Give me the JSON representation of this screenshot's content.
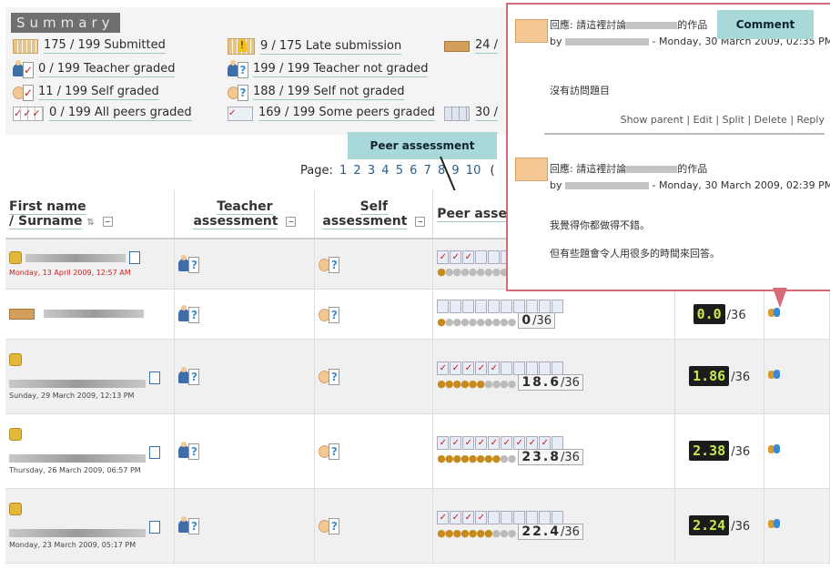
{
  "summary": {
    "title": "Summary",
    "rows": [
      {
        "label": "175 / 199 Submitted"
      },
      {
        "label": "9 / 175 Late submission"
      },
      {
        "label": "24 /"
      },
      {
        "label": "0 / 199 Teacher graded"
      },
      {
        "label": "199 / 199 Teacher not graded"
      },
      {
        "label": "11 / 199 Self graded"
      },
      {
        "label": "188 / 199 Self not graded"
      },
      {
        "label": "0 / 199 All peers graded"
      },
      {
        "label": "169 / 199 Some peers graded"
      },
      {
        "label": "30 /"
      }
    ]
  },
  "callouts": {
    "peer": "Peer assessment",
    "comment": "Comment"
  },
  "pager": {
    "label": "Page:",
    "pages": [
      "1",
      "2",
      "3",
      "4",
      "5",
      "6",
      "7",
      "8",
      "9",
      "10"
    ],
    "suffix": "("
  },
  "table": {
    "headers": {
      "name_line1": "First name",
      "name_line2": "/ Surname",
      "teacher_line1": "Teacher",
      "teacher_line2": "assessment",
      "self_line1": "Self",
      "self_line2": "assessment",
      "peer": "Peer asse"
    },
    "rows": [
      {
        "date": "Monday, 13 April 2009, 12:57 AM",
        "checks": 3,
        "score": "",
        "final": "",
        "den": ""
      },
      {
        "date": "",
        "checks": 0,
        "score": "0",
        "final": "0.0",
        "den": "/36"
      },
      {
        "date": "Sunday, 29 March 2009, 12:13 PM",
        "checks": 5,
        "score": "18.6",
        "final": "1.86",
        "den": "/36"
      },
      {
        "date": "Thursday, 26 March 2009, 06:57 PM",
        "checks": 9,
        "score": "23.8",
        "final": "2.38",
        "den": "/36"
      },
      {
        "date": "Monday, 23 March 2009, 05:17 PM",
        "checks": 4,
        "score": "22.4",
        "final": "2.24",
        "den": "/36"
      }
    ]
  },
  "popup": {
    "post1": {
      "title_prefix": "回應: 請這裡討論",
      "title_suffix": "的作品",
      "by": "by",
      "date": "- Monday, 30 March 2009, 02:35 PM",
      "message": "沒有訪問題目",
      "links": "Show parent | Edit | Split | Delete | Reply"
    },
    "post2": {
      "title_prefix": "回應: 請這裡討論",
      "title_suffix": "的作品",
      "by": "by",
      "date": "- Monday, 30 March 2009, 02:39 PM",
      "message1": "我覺得你都做得不錯。",
      "message2": "但有些題會令人用很多的時間來回答。"
    }
  }
}
